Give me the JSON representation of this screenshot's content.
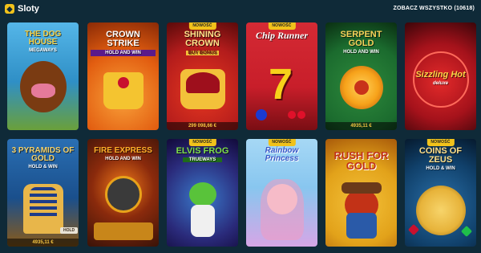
{
  "header": {
    "title": "Sloty",
    "see_all": "ZOBACZ WSZYSTKO (10618)"
  },
  "badge_new": "NOWOŚĆ",
  "games": [
    {
      "id": "dog-house",
      "title": "THE DOG HOUSE",
      "subtitle": "MEGAWAYS",
      "bg": "#2f8fc6",
      "accent": "#7a3b12"
    },
    {
      "id": "crown-strike",
      "title": "CROWN STRIKE",
      "subtitle": "HOLD AND WIN",
      "bg": "#e25d10",
      "accent": "#f4c430"
    },
    {
      "id": "shining-crown",
      "title": "SHINING CROWN",
      "subtitle": "BUY BONUS",
      "bg": "#b31c1c",
      "accent": "#f3c13a",
      "jackpot": "299 098,66 €"
    },
    {
      "id": "chip-runner",
      "title": "Chip Runner",
      "subtitle": "",
      "bg": "#c81e2a",
      "accent": "#f7d21a"
    },
    {
      "id": "serpent-gold",
      "title": "SERPENT GOLD",
      "subtitle": "HOLD AND WIN",
      "bg": "#1b6b2e",
      "accent": "#f7a21a",
      "jackpot": "4935,11 €"
    },
    {
      "id": "sizzling-hot",
      "title": "Sizzling Hot",
      "subtitle": "deluxe",
      "bg": "#a5121b",
      "accent": "#ffd447"
    },
    {
      "id": "pyramids-gold",
      "title": "3 PYRAMIDS OF GOLD",
      "subtitle": "HOLD & WIN",
      "bg": "#1a4f8c",
      "accent": "#e8b64a",
      "jackpot": "4935,11 €"
    },
    {
      "id": "fire-express",
      "title": "FIRE EXPRESS",
      "subtitle": "HOLD AND WIN",
      "bg": "#3a1308",
      "accent": "#f07a1a"
    },
    {
      "id": "elvis-frog",
      "title": "ELVIS FROG",
      "subtitle": "TRUEWAYS",
      "bg": "#2a2a7a",
      "accent": "#59c33a"
    },
    {
      "id": "rainbow-princess",
      "title": "Rainbow Princess",
      "subtitle": "",
      "bg": "#88c6ef",
      "accent": "#f29ac1"
    },
    {
      "id": "rush-for-gold",
      "title": "RUSH FOR GOLD",
      "subtitle": "",
      "bg": "#e2a21a",
      "accent": "#c23217"
    },
    {
      "id": "coins-of-zeus",
      "title": "COINS OF ZEUS",
      "subtitle": "HOLD & WIN",
      "bg": "#10406a",
      "accent": "#e7b33a"
    }
  ]
}
